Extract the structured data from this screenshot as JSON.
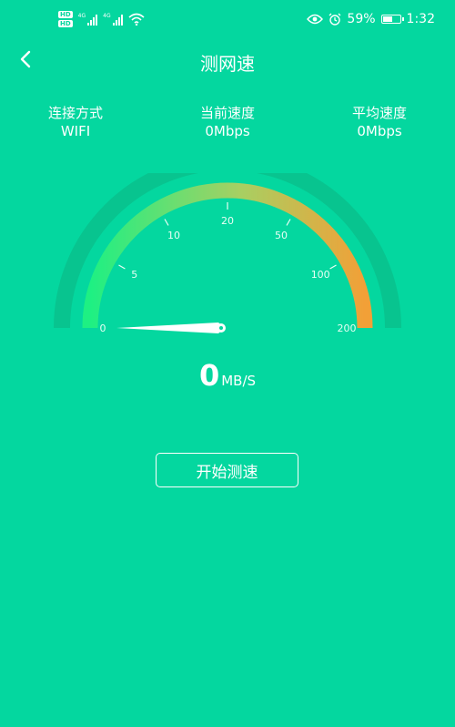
{
  "status_bar": {
    "network_badges": [
      "HD",
      "HD"
    ],
    "signal_tags": [
      "4G",
      "4G"
    ],
    "battery_percent": "59%",
    "battery_level": 0.59,
    "time": "1:32",
    "icons": [
      "eye-icon",
      "alarm-icon",
      "battery-icon",
      "wifi-icon",
      "signal-icon"
    ]
  },
  "header": {
    "title": "测网速",
    "back_icon": "chevron-left-icon"
  },
  "stats": [
    {
      "label": "连接方式",
      "value": "WIFI"
    },
    {
      "label": "当前速度",
      "value": "0Mbps"
    },
    {
      "label": "平均速度",
      "value": "0Mbps"
    }
  ],
  "gauge": {
    "scale_labels": [
      "0",
      "5",
      "10",
      "20",
      "50",
      "100",
      "200"
    ],
    "needle_value": 0,
    "colors": {
      "start": "#1ef083",
      "mid": "#a8cf62",
      "end": "#f2a037",
      "track": "#08c48f"
    }
  },
  "speed": {
    "value": "0",
    "unit": "MB/S"
  },
  "actions": {
    "start_label": "开始测速"
  },
  "colors": {
    "background": "#04d79f",
    "text": "#ffffff"
  }
}
